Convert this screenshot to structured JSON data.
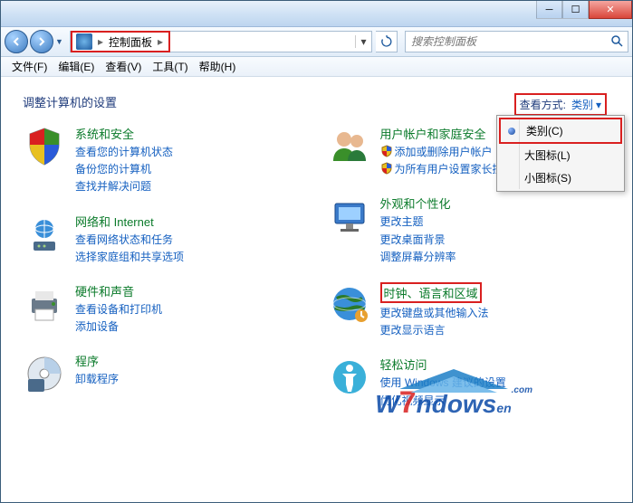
{
  "breadcrumb": {
    "label": "控制面板"
  },
  "search": {
    "placeholder": "搜索控制面板"
  },
  "menubar": [
    {
      "label": "文件(F)"
    },
    {
      "label": "编辑(E)"
    },
    {
      "label": "查看(V)"
    },
    {
      "label": "工具(T)"
    },
    {
      "label": "帮助(H)"
    }
  ],
  "page_title": "调整计算机的设置",
  "viewby": {
    "label": "查看方式:",
    "value": "类别"
  },
  "dropdown": [
    {
      "label": "类别(C)",
      "selected": true
    },
    {
      "label": "大图标(L)",
      "selected": false
    },
    {
      "label": "小图标(S)",
      "selected": false
    }
  ],
  "left_col": [
    {
      "title": "系统和安全",
      "links": [
        "查看您的计算机状态",
        "备份您的计算机",
        "查找并解决问题"
      ],
      "icon": "shield-color"
    },
    {
      "title": "网络和 Internet",
      "links": [
        "查看网络状态和任务",
        "选择家庭组和共享选项"
      ],
      "icon": "network"
    },
    {
      "title": "硬件和声音",
      "links": [
        "查看设备和打印机",
        "添加设备"
      ],
      "icon": "printer"
    },
    {
      "title": "程序",
      "links": [
        "卸载程序"
      ],
      "icon": "disc"
    }
  ],
  "right_col": [
    {
      "title": "用户帐户和家庭安全",
      "links": [
        "添加或删除用户帐户",
        "为所有用户设置家长控制"
      ],
      "icon": "users",
      "shields": [
        true,
        true
      ]
    },
    {
      "title": "外观和个性化",
      "links": [
        "更改主题",
        "更改桌面背景",
        "调整屏幕分辨率"
      ],
      "icon": "appearance"
    },
    {
      "title": "时钟、语言和区域",
      "links": [
        "更改键盘或其他输入法",
        "更改显示语言"
      ],
      "icon": "globe",
      "highlight": true
    },
    {
      "title": "轻松访问",
      "links": [
        "使用 Windows 建议的设置",
        "优化视频显示"
      ],
      "icon": "ease"
    }
  ],
  "watermark": {
    "brand_pre": "W",
    "brand_mid": "7",
    "brand_post": "ndows",
    "brand_suffix": "en",
    "tld": ".com"
  }
}
